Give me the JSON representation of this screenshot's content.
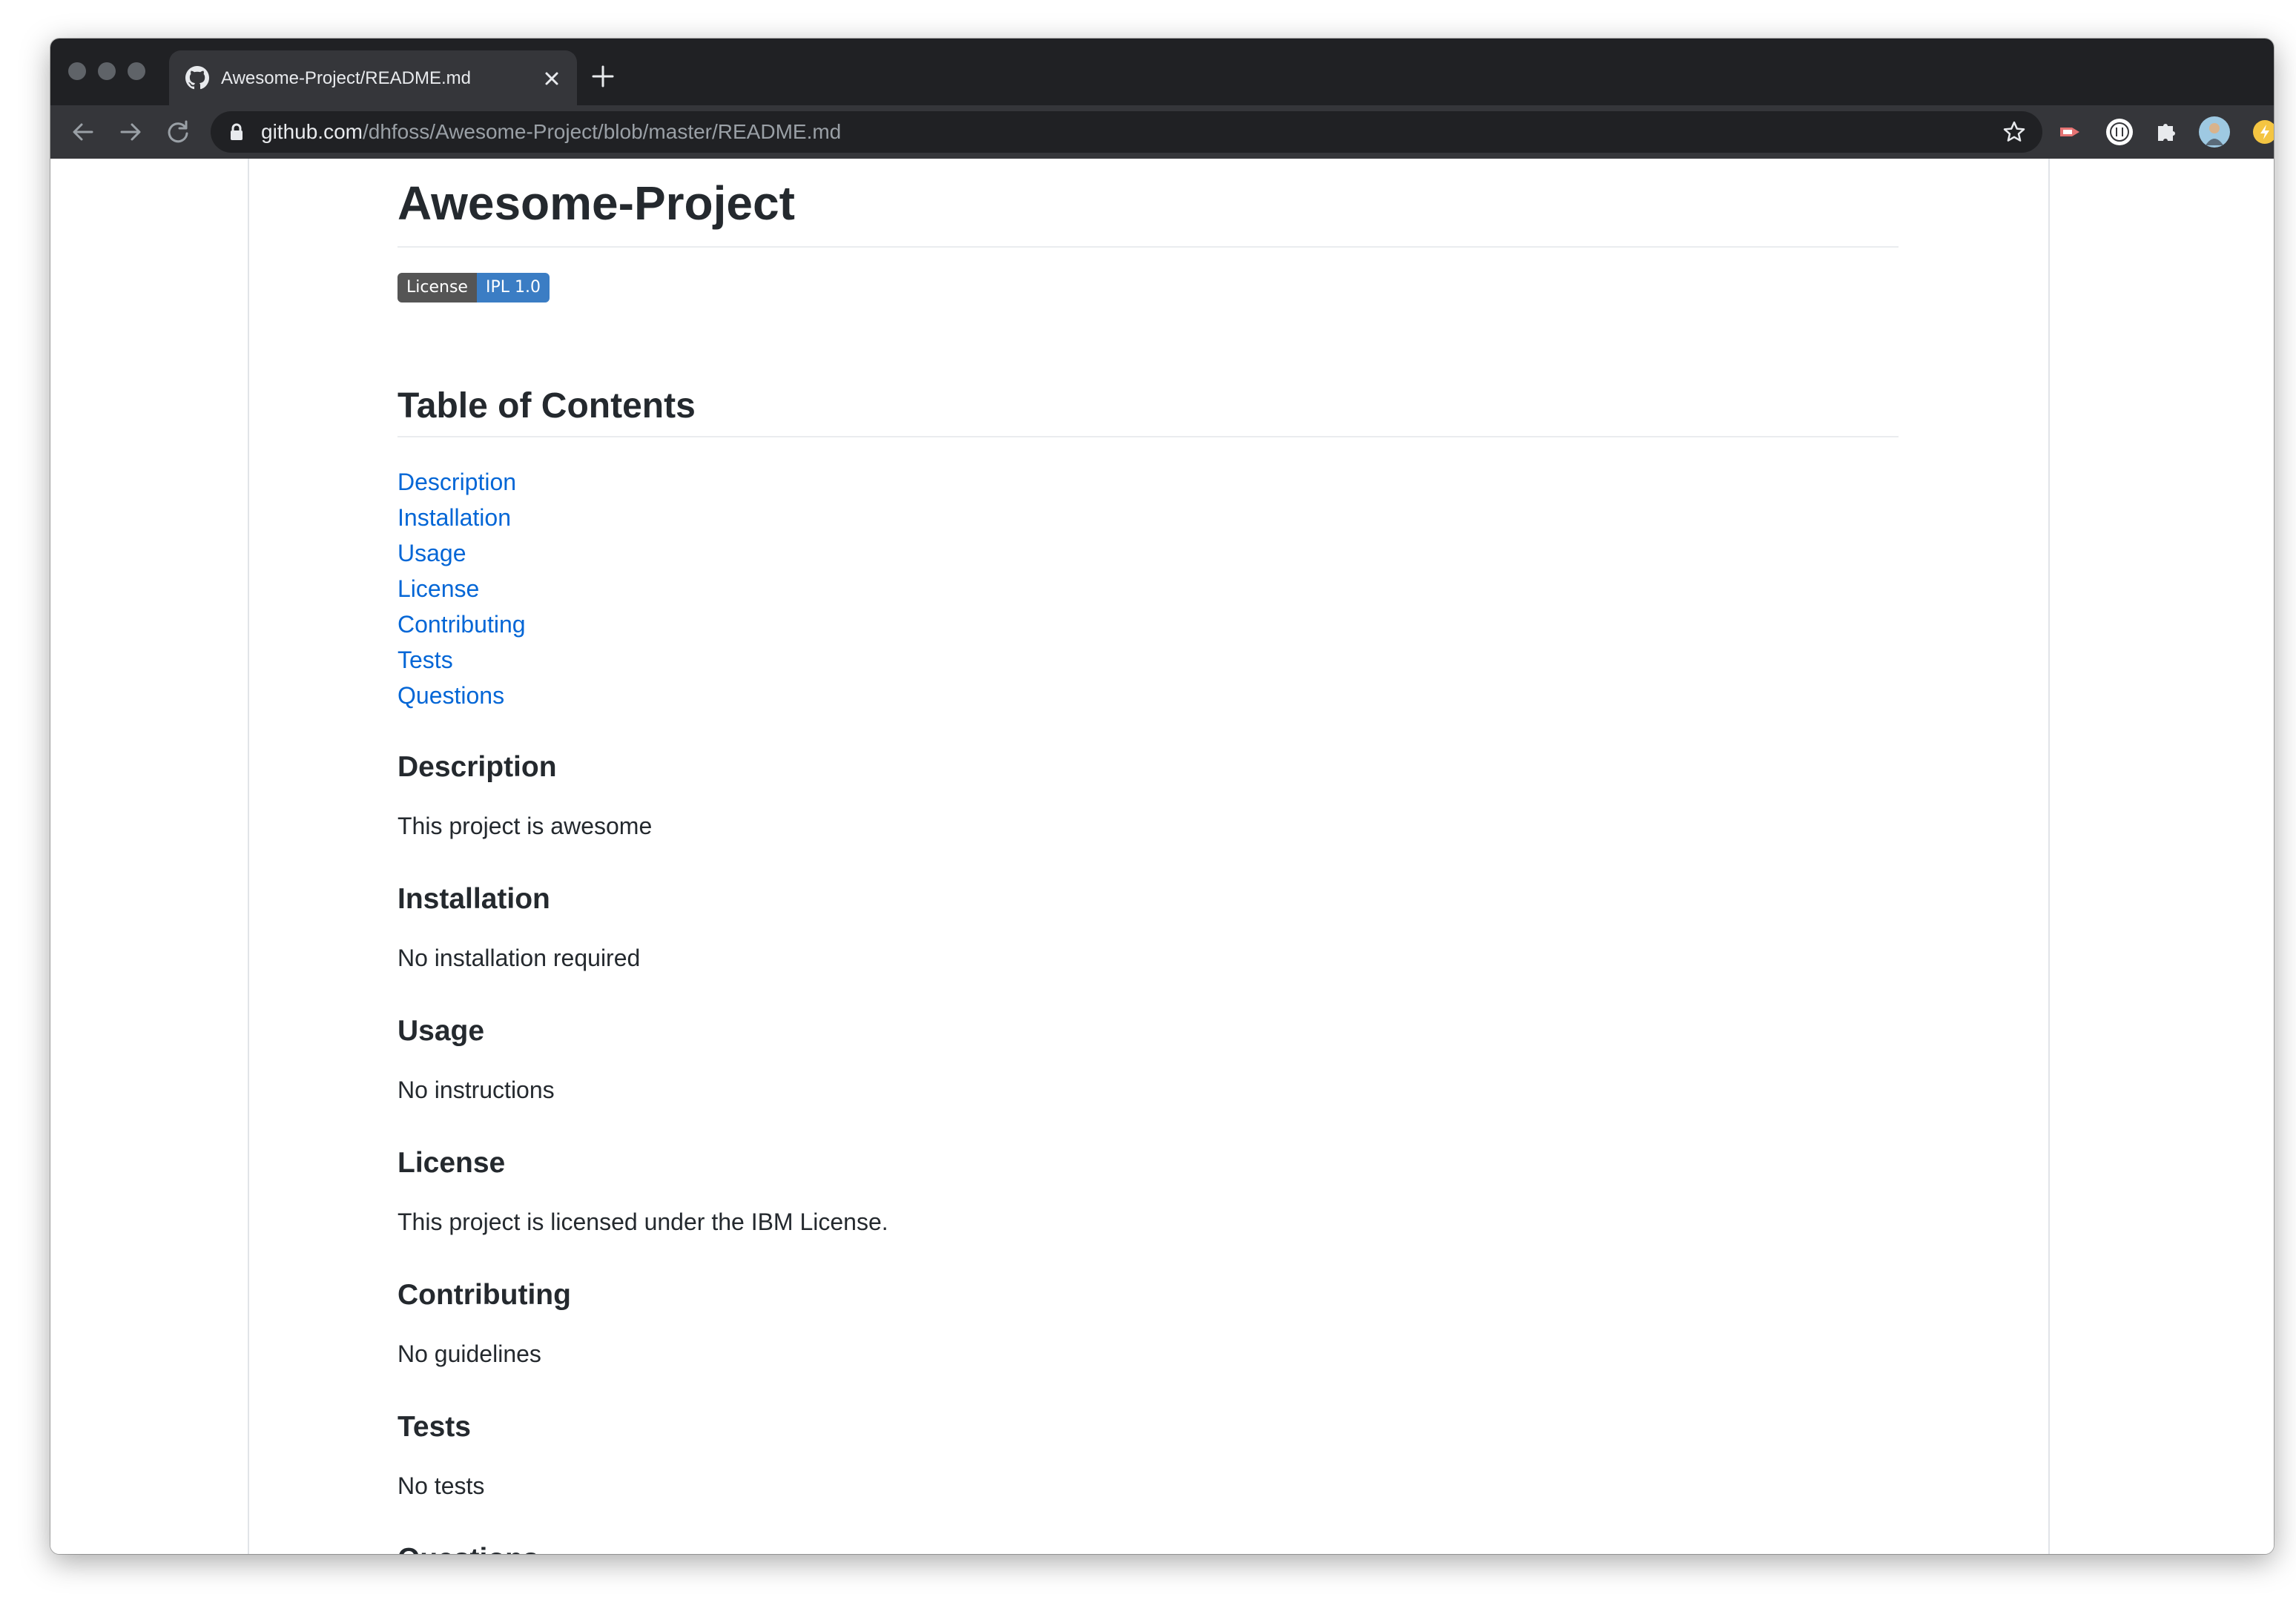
{
  "browser": {
    "tab_title": "Awesome-Project/README.md",
    "url_host": "github.com",
    "url_path": "/dhfoss/Awesome-Project/blob/master/README.md"
  },
  "readme": {
    "title": "Awesome-Project",
    "badge": {
      "label": "License",
      "value": "IPL 1.0",
      "label_color": "#555555",
      "value_color": "#3b7dc4"
    },
    "toc_heading": "Table of Contents",
    "toc": [
      "Description",
      "Installation",
      "Usage",
      "License",
      "Contributing",
      "Tests",
      "Questions"
    ],
    "sections": [
      {
        "heading": "Description",
        "text": "This project is awesome"
      },
      {
        "heading": "Installation",
        "text": "No installation required"
      },
      {
        "heading": "Usage",
        "text": "No instructions"
      },
      {
        "heading": "License",
        "text": "This project is licensed under the IBM License."
      },
      {
        "heading": "Contributing",
        "text": "No guidelines"
      },
      {
        "heading": "Tests",
        "text": "No tests"
      },
      {
        "heading": "Questions",
        "text": ""
      }
    ]
  },
  "colors": {
    "link": "#0366d6",
    "text": "#24292e",
    "chrome_dark": "#202124",
    "chrome_toolbar": "#35363a"
  },
  "icons": [
    "github-icon",
    "close-icon",
    "plus-icon",
    "back-arrow-icon",
    "forward-arrow-icon",
    "reload-icon",
    "lock-icon",
    "star-icon",
    "extension-icon",
    "puzzle-icon",
    "avatar",
    "lightning-icon"
  ]
}
